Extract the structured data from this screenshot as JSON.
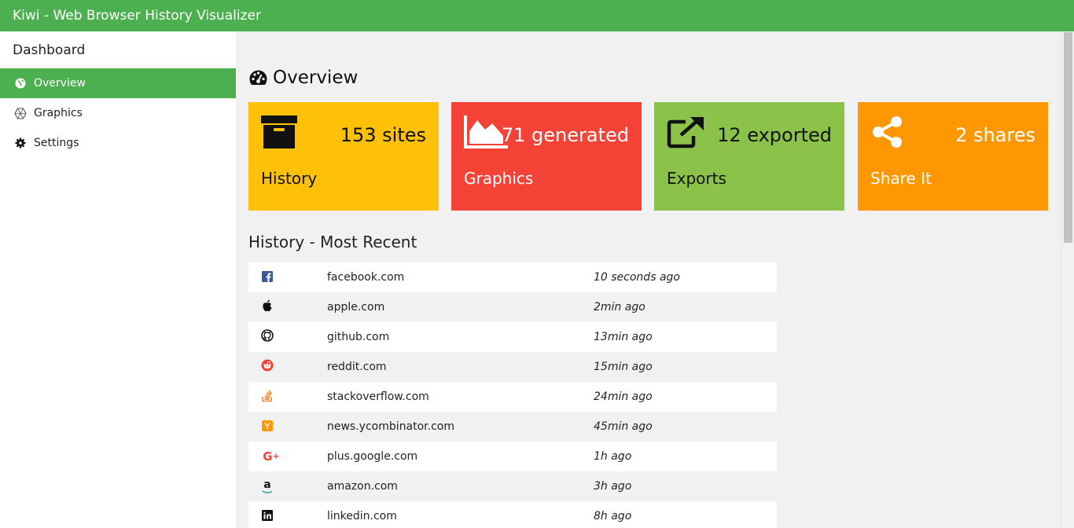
{
  "app": {
    "title": "Kiwi - Web Browser History Visualizer"
  },
  "sidebar": {
    "heading": "Dashboard",
    "items": [
      {
        "label": "Overview",
        "icon": "globe-icon",
        "active": true
      },
      {
        "label": "Graphics",
        "icon": "hexagon-icon",
        "active": false
      },
      {
        "label": "Settings",
        "icon": "gear-icon",
        "active": false
      }
    ]
  },
  "main": {
    "title": "Overview",
    "title_icon": "dashboard-gauge-icon",
    "cards": [
      {
        "stat": "153 sites",
        "label": "History",
        "icon": "archive-box-icon",
        "color": "#ffc107"
      },
      {
        "stat": "71 generated",
        "label": "Graphics",
        "icon": "area-chart-icon",
        "color": "#f44336"
      },
      {
        "stat": "12 exported",
        "label": "Exports",
        "icon": "external-link-icon",
        "color": "#8bc34a"
      },
      {
        "stat": "2 shares",
        "label": "Share It",
        "icon": "share-icon",
        "color": "#ff9800"
      }
    ],
    "history_title": "History - Most Recent",
    "history": [
      {
        "site": "facebook.com",
        "time": "10 seconds ago",
        "icon": "facebook-icon"
      },
      {
        "site": "apple.com",
        "time": "2min ago",
        "icon": "apple-icon"
      },
      {
        "site": "github.com",
        "time": "13min ago",
        "icon": "github-icon"
      },
      {
        "site": "reddit.com",
        "time": "15min ago",
        "icon": "reddit-icon"
      },
      {
        "site": "stackoverflow.com",
        "time": "24min ago",
        "icon": "stackoverflow-icon"
      },
      {
        "site": "news.ycombinator.com",
        "time": "45min ago",
        "icon": "ycombinator-icon"
      },
      {
        "site": "plus.google.com",
        "time": "1h ago",
        "icon": "google-plus-icon"
      },
      {
        "site": "amazon.com",
        "time": "3h ago",
        "icon": "amazon-icon"
      },
      {
        "site": "linkedin.com",
        "time": "8h ago",
        "icon": "linkedin-icon"
      }
    ]
  }
}
